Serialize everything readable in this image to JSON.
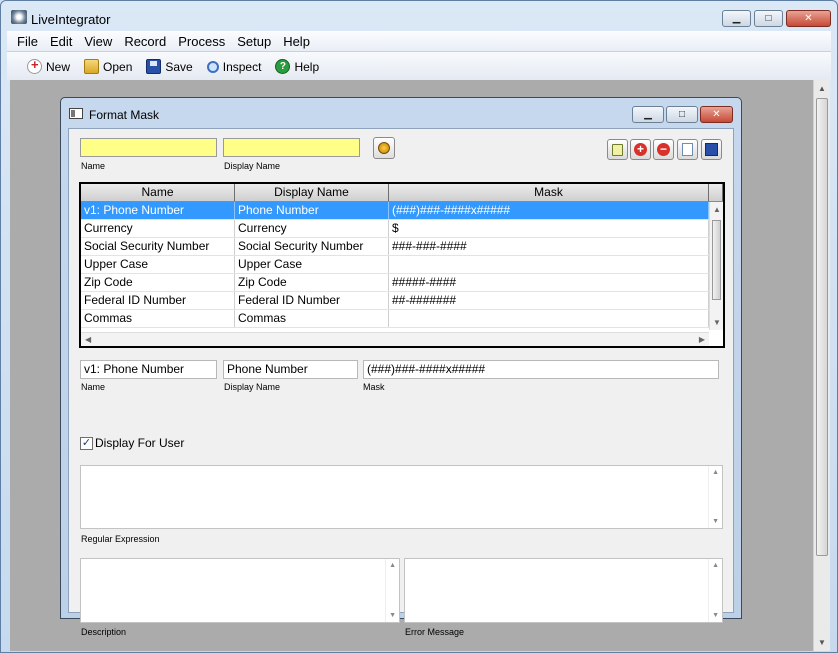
{
  "app": {
    "title": "LiveIntegrator"
  },
  "menu": [
    "File",
    "Edit",
    "View",
    "Record",
    "Process",
    "Setup",
    "Help"
  ],
  "toolbar": {
    "new": "New",
    "open": "Open",
    "save": "Save",
    "inspect": "Inspect",
    "help": "Help"
  },
  "window": {
    "title": "Format Mask"
  },
  "filter": {
    "name_label": "Name",
    "display_name_label": "Display  Name",
    "name_value": "",
    "display_name_value": ""
  },
  "grid": {
    "columns": [
      "Name",
      "Display Name",
      "Mask"
    ],
    "rows": [
      [
        "v1: Phone Number",
        "Phone Number",
        "(###)###-####x#####"
      ],
      [
        "Currency",
        "Currency",
        "$"
      ],
      [
        "Social Security Number",
        "Social Security Number",
        "###-###-####"
      ],
      [
        "Upper Case",
        "Upper Case",
        ""
      ],
      [
        "Zip Code",
        "Zip Code",
        "#####-####"
      ],
      [
        "Federal ID Number",
        "Federal ID Number",
        "##-#######"
      ],
      [
        "Commas",
        "Commas",
        ""
      ]
    ]
  },
  "detail": {
    "name_value": "v1: Phone Number",
    "name_label": "Name",
    "display_name_value": "Phone Number",
    "display_name_label": "Display  Name",
    "mask_value": "(###)###-####x#####",
    "mask_label": "Mask",
    "display_for_user_label": "Display For User",
    "regex_label": "Regular Expression",
    "description_label": "Description",
    "error_message_label": "Error Message"
  },
  "colors": {
    "highlight": "#3399ff",
    "filter_input": "#ffff88"
  }
}
